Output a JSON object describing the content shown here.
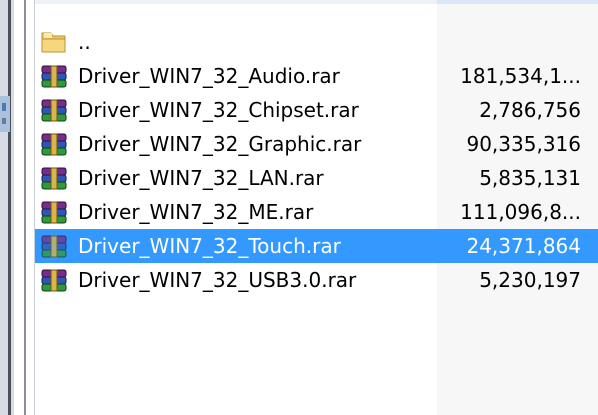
{
  "files": [
    {
      "name": "..",
      "size": "",
      "type": "folder-up",
      "selected": false
    },
    {
      "name": "Driver_WIN7_32_Audio.rar",
      "size": "181,534,1...",
      "type": "rar",
      "selected": false
    },
    {
      "name": "Driver_WIN7_32_Chipset.rar",
      "size": "2,786,756",
      "type": "rar",
      "selected": false
    },
    {
      "name": "Driver_WIN7_32_Graphic.rar",
      "size": "90,335,316",
      "type": "rar",
      "selected": false
    },
    {
      "name": "Driver_WIN7_32_LAN.rar",
      "size": "5,835,131",
      "type": "rar",
      "selected": false
    },
    {
      "name": "Driver_WIN7_32_ME.rar",
      "size": "111,096,8...",
      "type": "rar",
      "selected": false
    },
    {
      "name": "Driver_WIN7_32_Touch.rar",
      "size": "24,371,864",
      "type": "rar",
      "selected": true
    },
    {
      "name": "Driver_WIN7_32_USB3.0.rar",
      "size": "5,230,197",
      "type": "rar",
      "selected": false
    }
  ],
  "colors": {
    "selection": "#3399ff",
    "text": "#000000",
    "selected_text": "#ffffff",
    "folder": "#f2c75c"
  },
  "icons": {
    "folder-up": "folder-icon",
    "rar": "rar-archive-icon"
  }
}
